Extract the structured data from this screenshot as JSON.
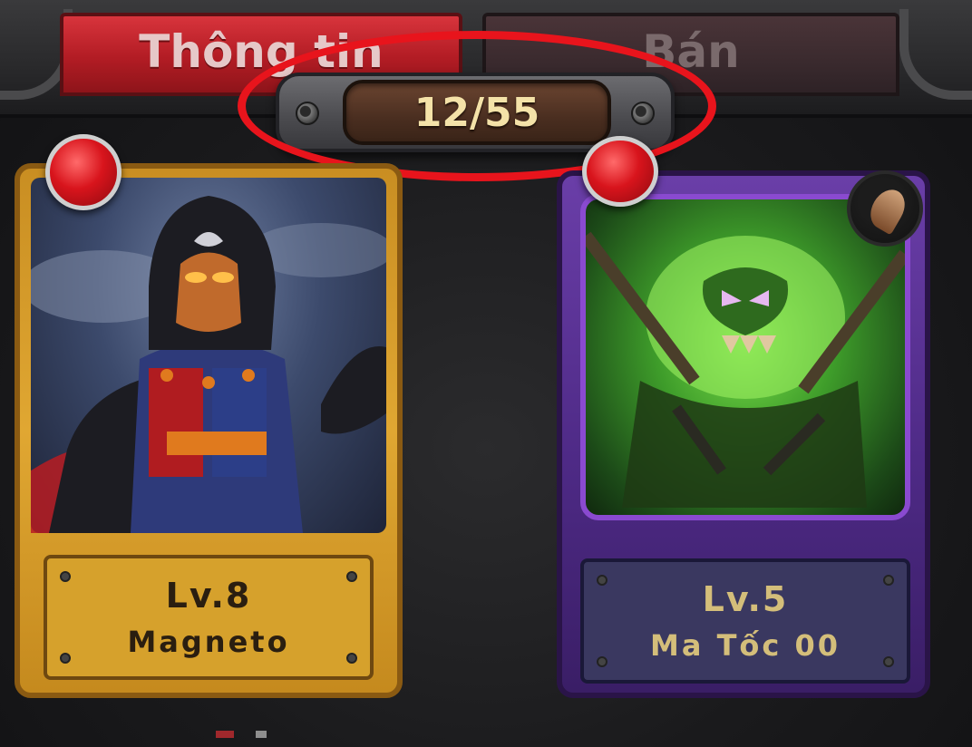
{
  "tabs": {
    "info_label": "Thông tin",
    "sell_label": "Bán"
  },
  "counter": {
    "value": "12/55"
  },
  "cards": [
    {
      "level": "Lv.8",
      "name": "Magneto",
      "rarity_color": "#e0a732",
      "element_badge": "red-gem-icon"
    },
    {
      "level": "Lv.5",
      "name": "Ma Tốc 00",
      "rarity_color": "#6a3ea8",
      "element_badge": "claw-icon"
    }
  ],
  "colors": {
    "highlight": "#e8141c",
    "counter_text": "#f4e2a8",
    "active_tab": "#d8343c"
  }
}
